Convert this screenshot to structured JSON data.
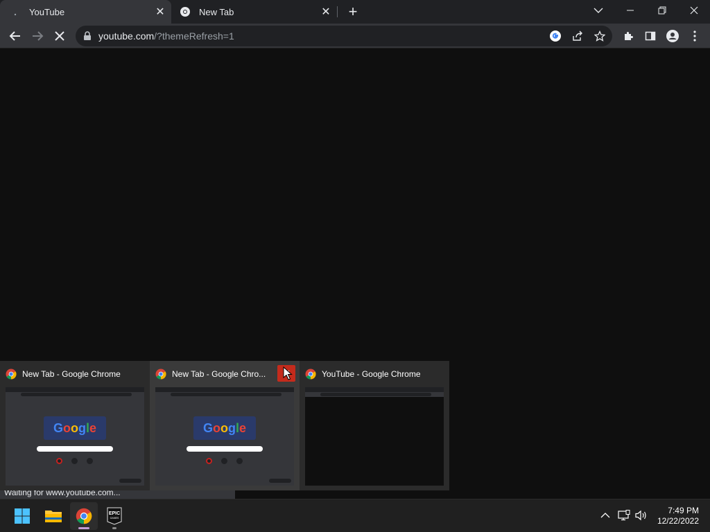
{
  "browser": {
    "tabs": [
      {
        "title": "YouTube",
        "active": true,
        "loading": true
      },
      {
        "title": "New Tab",
        "active": false
      }
    ],
    "url": {
      "domain": "youtube.com",
      "rest": "/?themeRefresh=1"
    },
    "status_text": "Waiting for www.youtube.com..."
  },
  "thumbnails": [
    {
      "title": "New Tab - Google Chrome",
      "hover": false
    },
    {
      "title": "New Tab - Google Chro...",
      "hover": true
    },
    {
      "title": "YouTube - Google Chrome",
      "hover": false
    }
  ],
  "taskbar": {
    "apps": [
      "windows-start",
      "file-explorer",
      "google-chrome",
      "epic-games-launcher"
    ],
    "epic_label": "EPIC GAMES",
    "time": "7:49 PM",
    "date": "12/22/2022"
  },
  "colors": {
    "tabstrip": "#202124",
    "toolbar": "#35363a",
    "content": "#0f0f0f",
    "close_hover": "#c42b1c"
  }
}
